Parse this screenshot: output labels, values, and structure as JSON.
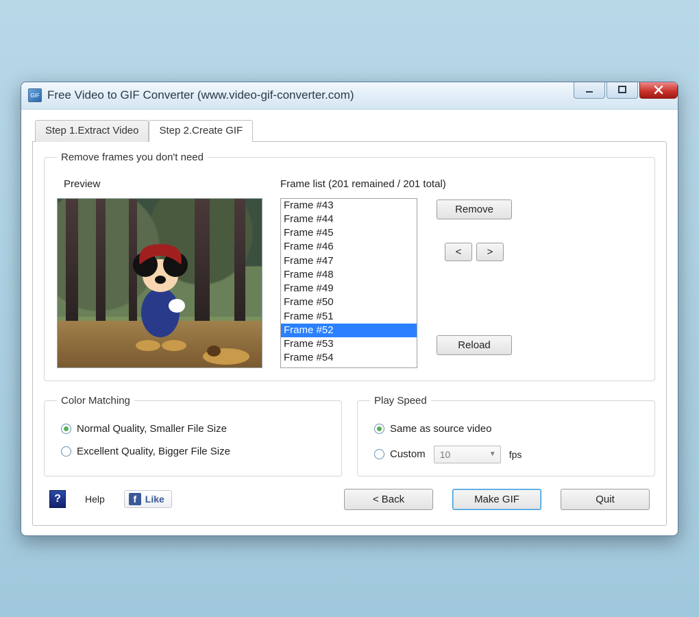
{
  "window": {
    "title": "Free Video to GIF Converter (www.video-gif-converter.com)"
  },
  "tabs": {
    "step1": "Step 1.Extract Video",
    "step2": "Step 2.Create GIF"
  },
  "frames_group": {
    "legend": "Remove frames you don't need",
    "preview_label": "Preview",
    "list_label": "Frame list (201 remained / 201 total)",
    "items": [
      "Frame #43",
      "Frame #44",
      "Frame #45",
      "Frame #46",
      "Frame #47",
      "Frame #48",
      "Frame #49",
      "Frame #50",
      "Frame #51",
      "Frame #52",
      "Frame #53",
      "Frame #54"
    ],
    "selected_index": 9,
    "remove_btn": "Remove",
    "prev_btn": "<",
    "next_btn": ">",
    "reload_btn": "Reload"
  },
  "color_matching": {
    "legend": "Color Matching",
    "option_normal": "Normal Quality, Smaller File Size",
    "option_excellent": "Excellent Quality, Bigger File Size",
    "selected": "normal"
  },
  "play_speed": {
    "legend": "Play Speed",
    "option_same": "Same as source video",
    "option_custom": "Custom",
    "fps_value": "10",
    "fps_unit": "fps",
    "selected": "same"
  },
  "footer": {
    "help": "Help",
    "like": "Like",
    "back": "< Back",
    "make_gif": "Make GIF",
    "quit": "Quit"
  }
}
